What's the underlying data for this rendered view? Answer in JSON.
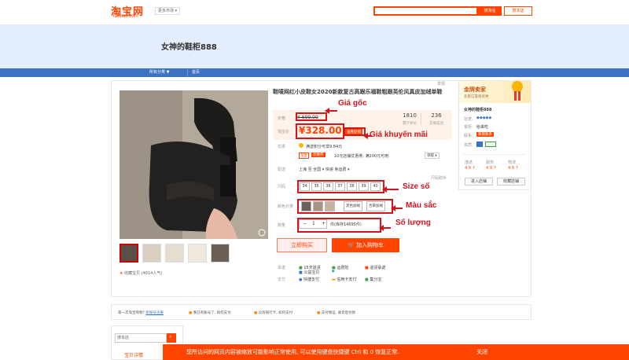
{
  "header": {
    "logo_cn": "淘宝网",
    "logo_en": "Taobao.com",
    "market": "更多市场 ▾",
    "search_btn": "搜淘宝",
    "search_shop": "搜本店",
    "search_placeholder": ""
  },
  "shop": {
    "name": "女神的鞋柜888"
  },
  "nav": {
    "all": "所有分类 ▼",
    "home": "首页"
  },
  "product": {
    "title": "鞋唛网红小皮鞋女2020新款复古高跟乐福鞋粗跟英伦风真皮加绒单鞋",
    "price_label": "价格",
    "old_price": "¥ 699.00",
    "promo_label": "淘宝价",
    "new_price": "¥328.00",
    "promo_tag": "查看促销",
    "reviews_count": "1810",
    "reviews_label": "累计评论",
    "sales_count": "236",
    "sales_label": "交易成功",
    "report": "举报",
    "coupon_label": "优惠",
    "coupon_text": "满送积分可享9.84元",
    "coupon_tag1": "淘金",
    "coupon_tag2": "优惠券",
    "coupon_detail": "10元店铺优惠券, 满200元可用",
    "coupon_more": "领取 ▾",
    "ship_label": "配送",
    "ship_text": "上海 至 全国 ▾  快递 免运费 ▾",
    "size_label": "尺码",
    "size_guide": "尺码助手",
    "sizes": [
      "34",
      "35",
      "36",
      "37",
      "38",
      "39",
      "40"
    ],
    "color_label": "颜色分类",
    "colors": [
      "黑色加绒",
      "杏黄加绒"
    ],
    "qty_label": "数量",
    "qty_minus": "−",
    "qty_value": "1",
    "qty_plus": "+",
    "stock": "件(库存14695件)",
    "buy_now": "立即购买",
    "add_cart": "加入购物车",
    "promise_label": "承诺",
    "promise1": "15天退货",
    "promise2": "运费险",
    "promise3": "退货承诺",
    "promise4": "公益宝贝",
    "pay_label": "支付",
    "pay1": "快捷支付",
    "pay2": "信用卡支付",
    "pay3": "集分宝",
    "fav": "收藏宝贝 (4614人气)"
  },
  "annotations": {
    "old_price": "Giá gốc",
    "new_price": "Giá khuyến mãi",
    "size": "Size số",
    "color": "Màu sắc",
    "qty": "Số lượng"
  },
  "seller": {
    "badge": "金牌卖家",
    "badge_sub": "卖家信誉值优秀",
    "name": "女神的鞋柜888",
    "credit_label": "信誉:",
    "shop_label": "掌柜:",
    "shop_val": "给来吃",
    "contact_label": "联系:",
    "contact_val": "和我联系",
    "qual_label": "资质:",
    "desc_label": "描述",
    "desc_val": "4.9 ↑",
    "service_label": "服务",
    "service_val": "4.9 ↑",
    "logistics_label": "物流",
    "logistics_val": "4.9 ↑",
    "enter_shop": "进入店铺",
    "fav_shop": "收藏店铺"
  },
  "bottom": {
    "q1": "第一次淘宝购物?",
    "q1_link": "新账号注册",
    "q2": "我已有账号了, 如何支付",
    "q3": "没有银行卡, 如何支付",
    "q4": "支付保证, 收货后付款"
  },
  "side_search": {
    "placeholder": "搜本店",
    "tab": "宝贝详情"
  },
  "notice": {
    "text": "您所访问的网页内容被缩放可能影响正常使用, 可以使用键盘快捷键 Ctrl 和 0 恢复正常.",
    "close": "关闭"
  },
  "colors": {
    "brand": "#ff4400",
    "nav": "#3b73c2",
    "banner": "#e3edfb",
    "annotation": "#d5151e"
  }
}
